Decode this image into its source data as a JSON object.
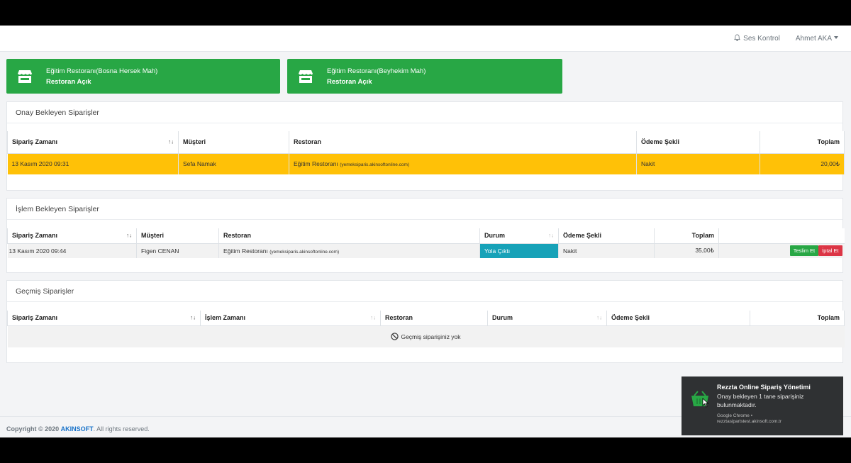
{
  "topbar": {
    "sound_label": "Ses Kontrol",
    "user_name": "Ahmet AKA"
  },
  "restaurant_cards": [
    {
      "name": "Eğitim Restoranı(Bosna Hersek Mah)",
      "status": "Restoran Açık"
    },
    {
      "name": "Eğitim Restoranı(Beyhekim Mah)",
      "status": "Restoran Açık"
    }
  ],
  "pending_approval": {
    "title": "Onay Bekleyen Siparişler",
    "headers": [
      "Sipariş Zamanı",
      "Müşteri",
      "Restoran",
      "Ödeme Şekli",
      "Toplam"
    ],
    "rows": [
      {
        "time": "13 Kasım 2020 09:31",
        "customer": "Sefa Namak",
        "restaurant": "Eğitim Restoranı",
        "restaurant_url": "(yemeksiparis.akinsoftonline.com)",
        "payment": "Nakit",
        "total": "20,00₺"
      }
    ]
  },
  "pending_process": {
    "title": "İşlem Bekleyen Siparişler",
    "headers": [
      "Sipariş Zamanı",
      "Müşteri",
      "Restoran",
      "Durum",
      "Ödeme Şekli",
      "Toplam"
    ],
    "rows": [
      {
        "time": "13 Kasım 2020 09:44",
        "customer": "Figen CENAN",
        "restaurant": "Eğitim Restoranı",
        "restaurant_url": "(yemeksiparis.akinsoftonline.com)",
        "status": "Yola Çıktı",
        "payment": "Nakit",
        "total": "35,00₺",
        "deliver_label": "Teslim Et",
        "cancel_label": "İptal Et"
      }
    ]
  },
  "history": {
    "title": "Geçmiş Siparişler",
    "headers": [
      "Sipariş Zamanı",
      "İşlem Zamanı",
      "Restoran",
      "Durum",
      "Ödeme Şekli",
      "Toplam"
    ],
    "empty_text": "Geçmiş siparişiniz yok"
  },
  "footer": {
    "prefix": "Copyright © 2020",
    "brand": "AKINSOFT",
    "suffix": ". All rights reserved."
  },
  "notification": {
    "title": "Rezzta Online Sipariş Yönetimi",
    "message": "Onay bekleyen 1 tane siparişiniz bulunmaktadır.",
    "source_line1": "Google Chrome •",
    "source_line2": "rezztasiparistest.akinsoft.com.tr"
  },
  "colors": {
    "green": "#28a745",
    "highlight_row": "#ffc107",
    "status_teal": "#17a2b8",
    "danger": "#dc3545",
    "brand_blue": "#1a73c9"
  }
}
